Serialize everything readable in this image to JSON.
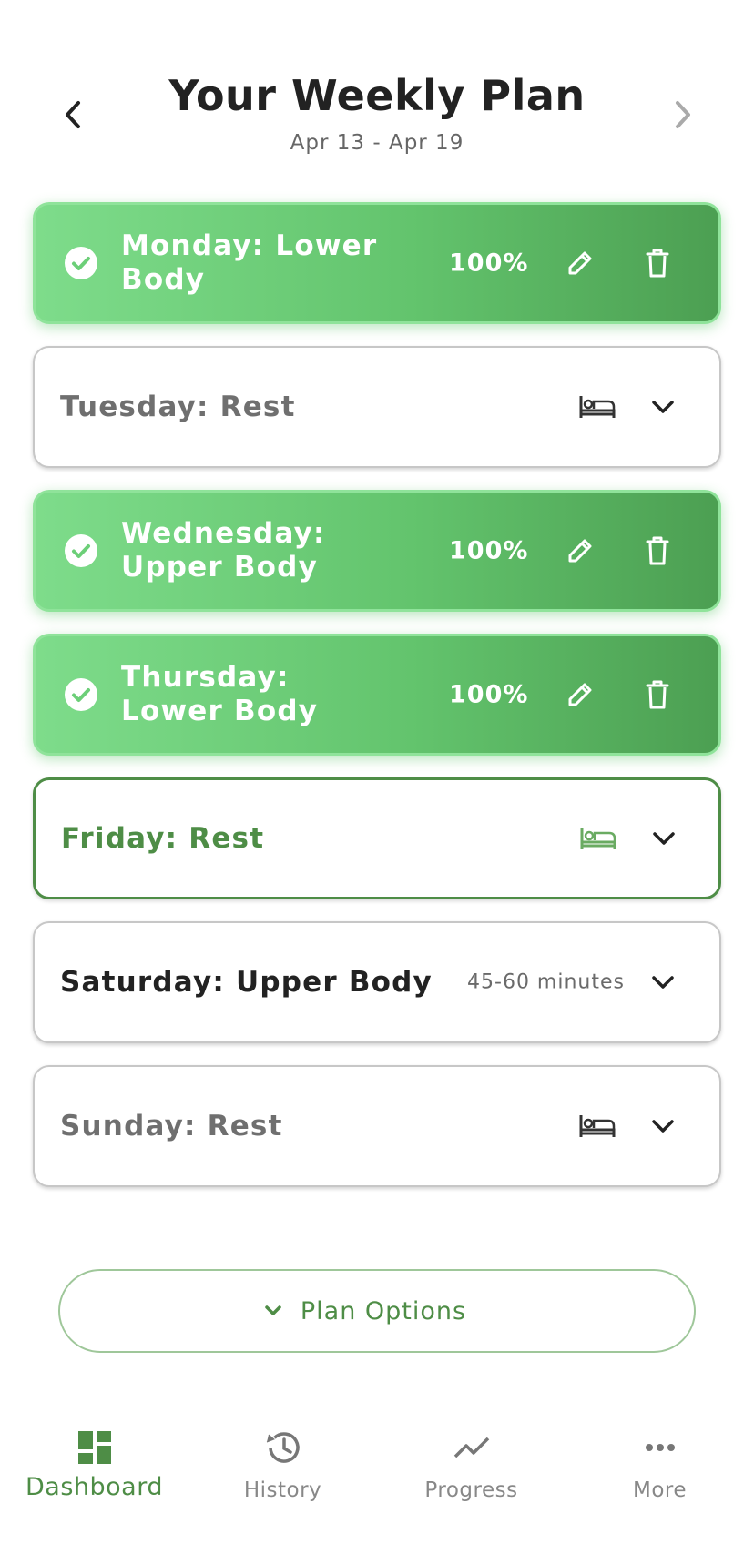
{
  "header": {
    "title": "Your Weekly Plan",
    "date_range": "Apr 13 - Apr 19"
  },
  "days": [
    {
      "title": "Monday: Lower Body",
      "status": "completed",
      "progress": "100%"
    },
    {
      "title": "Tuesday: Rest",
      "status": "rest"
    },
    {
      "title": "Wednesday: Upper Body",
      "status": "completed",
      "progress": "100%"
    },
    {
      "title": "Thursday: Lower Body",
      "status": "completed",
      "progress": "100%"
    },
    {
      "title": "Friday: Rest",
      "status": "rest-selected"
    },
    {
      "title": "Saturday: Upper Body",
      "status": "planned",
      "duration": "45-60 minutes"
    },
    {
      "title": "Sunday: Rest",
      "status": "rest"
    }
  ],
  "plan_options": {
    "label": "Plan Options"
  },
  "bottom_nav": {
    "items": [
      {
        "label": "Dashboard",
        "icon": "dashboard-icon",
        "active": true
      },
      {
        "label": "History",
        "icon": "history-icon",
        "active": false
      },
      {
        "label": "Progress",
        "icon": "progress-icon",
        "active": false
      },
      {
        "label": "More",
        "icon": "more-icon",
        "active": false
      }
    ]
  },
  "colors": {
    "accent": "#4e8d46",
    "completed_start": "#7edc8b",
    "completed_end": "#4c9f52",
    "muted_text": "#6f6f6f"
  }
}
